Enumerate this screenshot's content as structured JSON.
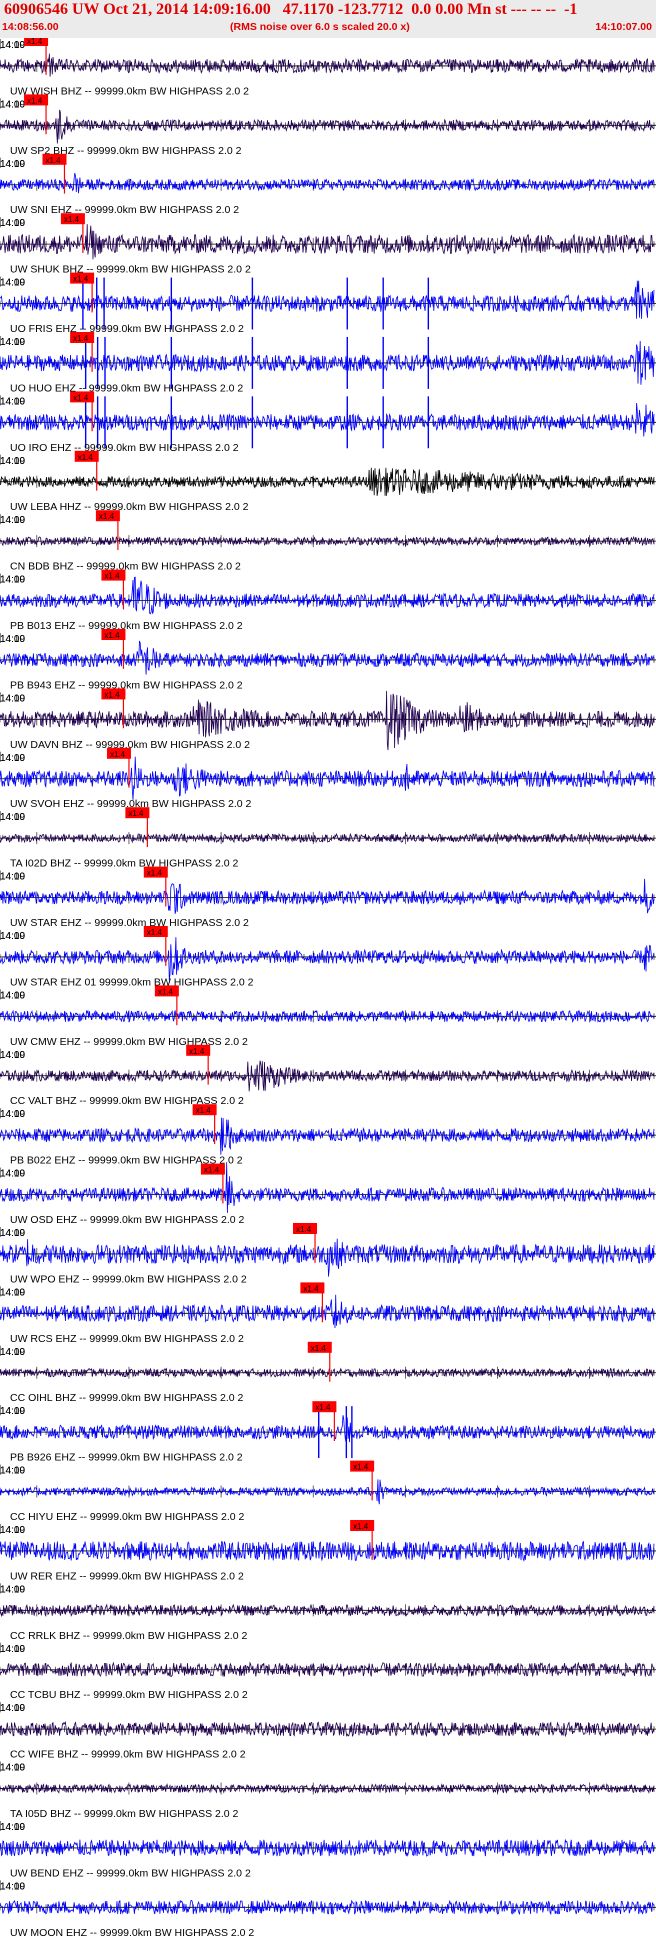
{
  "header": {
    "title": "60906546 UW Oct 21, 2014 14:09:16.00   47.1170 -123.7712  0.0 0.00 Mn st --- -- --  -1",
    "start_time": "14:08:56.00",
    "note": "(RMS noise over 6.0 s scaled 20.0 x)",
    "end_time": "14:10:07.00"
  },
  "chart_data": {
    "type": "line",
    "title": "60906546 UW Oct 21, 2014 14:09:16.00   47.1170 -123.7712  0.0 0.00 Mn st --- -- --  -1",
    "x_range": [
      "14:08:56.00",
      "14:10:07.00"
    ],
    "time_tick_labels": [
      "14:09",
      "14:10"
    ],
    "pick_label": "x1.4",
    "colors": {
      "blue": "#0000ff",
      "dark": "#200050",
      "black": "#000000",
      "pick": "#ff0000",
      "text": "#000000"
    },
    "traces": [
      {
        "label": "UW WISH BHZ -- 99999.0km BW  HIGHPASS  2.0  2",
        "pick": "14:09:01.0",
        "color": "dark",
        "amp": 0.25,
        "bursts": [
          {
            "t": "14:09:01.3",
            "a": 0.6,
            "d": 0.8
          }
        ]
      },
      {
        "label": "UW SP2 BHZ -- 99999.0km BW  HIGHPASS  2.0  2",
        "pick": "14:09:01.0",
        "color": "dark",
        "amp": 0.2,
        "bursts": [
          {
            "t": "14:09:02.2",
            "a": 0.9,
            "d": 1.2
          }
        ]
      },
      {
        "label": "UW SNI EHZ -- 99999.0km BW  HIGHPASS  2.0  2",
        "pick": "14:09:03.0",
        "color": "blue",
        "amp": 0.2,
        "bursts": [
          {
            "t": "14:09:04.0",
            "a": 0.6,
            "d": 1.0
          }
        ]
      },
      {
        "label": "UW SHUK BHZ -- 99999.0km BW  HIGHPASS  2.0  2",
        "pick": "14:09:05.0",
        "color": "dark",
        "amp": 0.35,
        "bursts": [
          {
            "t": "14:09:05.5",
            "a": 0.9,
            "d": 1.5
          }
        ]
      },
      {
        "label": "UO FRIS EHZ -- 99999.0km BW  HIGHPASS  2.0  2",
        "pick": "14:09:06.0",
        "color": "blue",
        "amp": 0.3,
        "spikes": [
          "14:09:05.0",
          "14:09:06.5",
          "14:09:07.3",
          "14:09:14.6",
          "14:09:23.4",
          "14:09:33.7",
          "14:09:37.6",
          "14:09:42.5"
        ],
        "bursts": [
          {
            "t": "14:10:05.0",
            "a": 1.0,
            "d": 3.0
          }
        ]
      },
      {
        "label": "UO HUO EHZ -- 99999.0km BW  HIGHPASS  2.0  2",
        "pick": "14:09:06.0",
        "color": "blue",
        "amp": 0.3,
        "spikes": [
          "14:09:05.3",
          "14:09:06.6",
          "14:09:07.4",
          "14:09:14.6",
          "14:09:23.4",
          "14:09:33.7",
          "14:09:37.6",
          "14:09:42.5"
        ],
        "bursts": [
          {
            "t": "14:10:05.0",
            "a": 1.0,
            "d": 3.0
          }
        ]
      },
      {
        "label": "UO IRO EHZ -- 99999.0km BW  HIGHPASS  2.0  2",
        "pick": "14:09:06.0",
        "color": "blue",
        "amp": 0.3,
        "spikes": [
          "14:09:05.3",
          "14:09:06.6",
          "14:09:07.4",
          "14:09:14.6",
          "14:09:23.4",
          "14:09:33.7",
          "14:09:37.6",
          "14:09:42.5"
        ],
        "bursts": [
          {
            "t": "14:10:05.0",
            "a": 1.0,
            "d": 3.0
          }
        ]
      },
      {
        "label": "UW LEBA HHZ -- 99999.0km BW  HIGHPASS  2.0  2",
        "pick": "14:09:06.5",
        "color": "black",
        "amp": 0.2,
        "bursts": [
          {
            "t": "14:09:36.0",
            "a": 0.55,
            "d": 30.0
          }
        ]
      },
      {
        "label": "CN BDB BHZ -- 99999.0km BW  HIGHPASS  2.0  2",
        "pick": "14:09:08.8",
        "color": "dark",
        "amp": 0.15
      },
      {
        "label": "PB B013 EHZ -- 99999.0km BW  HIGHPASS  2.0  2",
        "pick": "14:09:09.4",
        "color": "blue",
        "amp": 0.25,
        "bursts": [
          {
            "t": "14:09:10.5",
            "a": 1.1,
            "d": 3.0
          }
        ]
      },
      {
        "label": "PB B943 EHZ -- 99999.0km BW  HIGHPASS  2.0  2",
        "pick": "14:09:09.4",
        "color": "blue",
        "amp": 0.25,
        "bursts": [
          {
            "t": "14:09:11.0",
            "a": 0.8,
            "d": 3.0
          }
        ]
      },
      {
        "label": "UW DAVN BHZ -- 99999.0km BW  HIGHPASS  2.0  2",
        "pick": "14:09:09.4",
        "color": "dark",
        "amp": 0.3,
        "bursts": [
          {
            "t": "14:09:17.0",
            "a": 0.8,
            "d": 8.0
          },
          {
            "t": "14:09:38.0",
            "a": 1.3,
            "d": 4.0
          },
          {
            "t": "14:09:46.0",
            "a": 0.8,
            "d": 3.0
          }
        ]
      },
      {
        "label": "UW SVOH EHZ -- 99999.0km BW  HIGHPASS  2.0  2",
        "pick": "14:09:10.0",
        "color": "blue",
        "amp": 0.3,
        "bursts": [
          {
            "t": "14:09:10.4",
            "a": 1.1,
            "d": 1.0
          },
          {
            "t": "14:09:15.0",
            "a": 0.8,
            "d": 4.0
          },
          {
            "t": "14:09:40.0",
            "a": 0.6,
            "d": 2.0
          }
        ]
      },
      {
        "label": "TA I02D BHZ -- 99999.0km BW  HIGHPASS  2.0  2",
        "pick": "14:09:12.0",
        "color": "dark",
        "amp": 0.15
      },
      {
        "label": "UW STAR EHZ -- 99999.0km BW  HIGHPASS  2.0  2",
        "pick": "14:09:14.0",
        "color": "blue",
        "amp": 0.25,
        "bursts": [
          {
            "t": "14:09:14.4",
            "a": 1.1,
            "d": 1.5
          },
          {
            "t": "14:10:06.0",
            "a": 0.8,
            "d": 1.0
          }
        ]
      },
      {
        "label": "UW STAR EHZ 01 99999.0km BW  HIGHPASS  2.0  2",
        "pick": "14:09:14.0",
        "color": "blue",
        "amp": 0.25,
        "bursts": [
          {
            "t": "14:09:14.4",
            "a": 1.2,
            "d": 1.5
          },
          {
            "t": "14:10:06.0",
            "a": 0.8,
            "d": 1.0
          }
        ]
      },
      {
        "label": "UW CMW EHZ -- 99999.0km BW  HIGHPASS  2.0  2",
        "pick": "14:09:15.2",
        "color": "blue",
        "amp": 0.2
      },
      {
        "label": "CC VALT BHZ -- 99999.0km BW  HIGHPASS  2.0  2",
        "pick": "14:09:18.6",
        "color": "dark",
        "amp": 0.2,
        "bursts": [
          {
            "t": "14:09:23.0",
            "a": 0.9,
            "d": 4.0
          }
        ]
      },
      {
        "label": "PB B022 EHZ -- 99999.0km BW  HIGHPASS  2.0  2",
        "pick": "14:09:19.3",
        "color": "blue",
        "amp": 0.25,
        "bursts": [
          {
            "t": "14:09:20.0",
            "a": 0.9,
            "d": 1.8
          }
        ]
      },
      {
        "label": "UW OSD EHZ -- 99999.0km BW  HIGHPASS  2.0  2",
        "pick": "14:09:20.2",
        "color": "blue",
        "amp": 0.25,
        "bursts": [
          {
            "t": "14:09:20.6",
            "a": 1.2,
            "d": 1.0
          }
        ]
      },
      {
        "label": "UW WPO EHZ -- 99999.0km BW  HIGHPASS  2.0  2",
        "pick": "14:09:30.2",
        "color": "blue",
        "amp": 0.35,
        "bursts": [
          {
            "t": "14:09:31.5",
            "a": 0.9,
            "d": 2.5
          },
          {
            "t": "14:08:59.0",
            "a": 0.7,
            "d": 2.0
          }
        ]
      },
      {
        "label": "UW RCS EHZ -- 99999.0km BW  HIGHPASS  2.0  2",
        "pick": "14:09:31.0",
        "color": "blue",
        "amp": 0.3,
        "bursts": [
          {
            "t": "14:09:32.0",
            "a": 0.9,
            "d": 2.0
          }
        ]
      },
      {
        "label": "CC OIHL BHZ -- 99999.0km BW  HIGHPASS  2.0  2",
        "pick": "14:09:31.8",
        "color": "dark",
        "amp": 0.15
      },
      {
        "label": "PB B926 EHZ -- 99999.0km BW  HIGHPASS  2.0  2",
        "pick": "14:09:32.3",
        "color": "blue",
        "amp": 0.25,
        "spikes": [
          "14:09:30.6",
          "14:09:33.6",
          "14:09:34.2"
        ],
        "bursts": [
          {
            "t": "14:09:33.2",
            "a": 1.0,
            "d": 0.8
          }
        ]
      },
      {
        "label": "CC HIYU EHZ -- 99999.0km BW  HIGHPASS  2.0  2",
        "pick": "14:09:36.4",
        "color": "blue",
        "amp": 0.15,
        "bursts": [
          {
            "t": "14:09:37.0",
            "a": 0.7,
            "d": 0.8
          }
        ]
      },
      {
        "label": "UW RER EHZ -- 99999.0km BW  HIGHPASS  2.0  2",
        "pick": "14:09:36.4",
        "color": "blue",
        "amp": 0.35
      },
      {
        "label": "CC RRLK BHZ -- 99999.0km BW  HIGHPASS  2.0  2",
        "color": "dark",
        "amp": 0.2
      },
      {
        "label": "CC TCBU BHZ -- 99999.0km BW  HIGHPASS  2.0  2",
        "color": "dark",
        "amp": 0.25
      },
      {
        "label": "CC WIFE BHZ -- 99999.0km BW  HIGHPASS  2.0  2",
        "color": "dark",
        "amp": 0.25
      },
      {
        "label": "TA I05D BHZ -- 99999.0km BW  HIGHPASS  2.0  2",
        "color": "dark",
        "amp": 0.15
      },
      {
        "label": "UW BEND EHZ -- 99999.0km BW  HIGHPASS  2.0  2",
        "color": "blue",
        "amp": 0.3
      },
      {
        "label": "UW MOON EHZ -- 99999.0km BW  HIGHPASS  2.0  2",
        "color": "blue",
        "amp": 0.25
      }
    ]
  }
}
